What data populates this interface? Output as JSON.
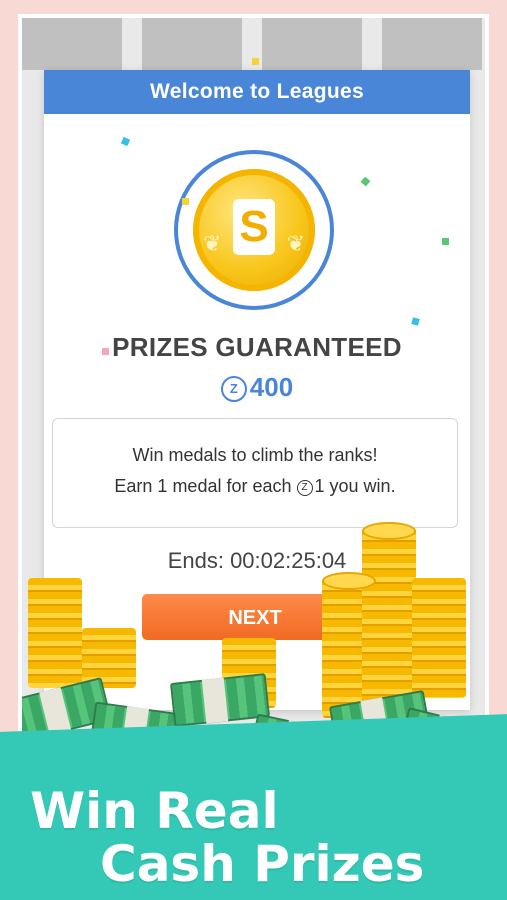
{
  "modal": {
    "title": "Welcome to Leagues",
    "coin_glyph": "S",
    "headline": "PRIZES GUARANTEED",
    "currency_symbol": "Z",
    "prize_amount": "400",
    "info_line_1": "Win medals to climb the ranks!",
    "info_line_2_prefix": "Earn 1 medal for each ",
    "info_line_2_amount": "1",
    "info_line_2_suffix": " you win.",
    "ends_label": "Ends: 00:02:25:04",
    "next_label": "NEXT"
  },
  "promo": {
    "line_1": "Win Real",
    "line_2": "Cash Prizes"
  },
  "colors": {
    "header_blue": "#4a86d8",
    "button_orange": "#f06a23",
    "promo_teal": "#33c9b6",
    "coin_gold": "#f8c61a"
  }
}
